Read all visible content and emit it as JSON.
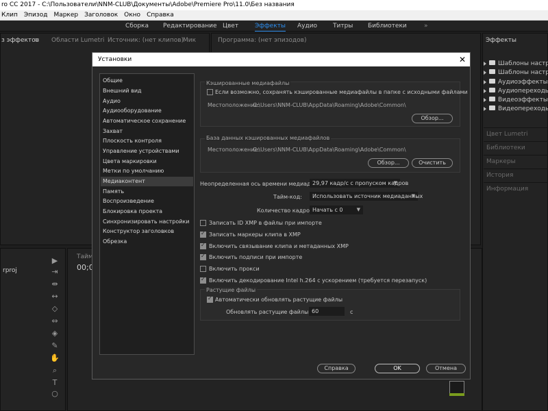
{
  "window": {
    "title": "ro CC 2017 - C:\\Пользователи\\NNM-CLUB\\Документы\\Adobe\\Premiere Pro\\11.0\\Без названия"
  },
  "menu": [
    "Клип",
    "Эпизод",
    "Маркер",
    "Заголовок",
    "Окно",
    "Справка"
  ],
  "workspaces": {
    "items": [
      "Сборка",
      "Редактирование",
      "Цвет",
      "Эффекты",
      "Аудио",
      "Титры",
      "Библиотеки"
    ],
    "active": "Эффекты",
    "more": "»"
  },
  "panels": {
    "effect_controls": "з эффектов",
    "lumetri_scopes": "Области Lumetri",
    "source": "Источник: (нет клипов)",
    "mixer": "Мик",
    "program": "Программа: (нет эпизодов)",
    "effects": "Эффекты",
    "timeline": "Тайм",
    "timecode": "00;0",
    "project_file": "rproj",
    "right_sections": [
      "Цвет Lumetri",
      "Библиотеки",
      "Маркеры",
      "История",
      "Информация"
    ],
    "effects_tree": [
      "Шаблоны настроек",
      "Шаблоны настроек",
      "Аудиоэффекты",
      "Аудиопереходы",
      "Видеоэффекты",
      "Видеопереходы"
    ]
  },
  "dialog": {
    "title": "Установки",
    "close": "✕",
    "categories": [
      "Общие",
      "Внешний вид",
      "Аудио",
      "Аудиооборудование",
      "Автоматическое сохранение",
      "Захват",
      "Плоскость контроля",
      "Управление устройствами",
      "Цвета маркировки",
      "Метки по умолчанию",
      "Медиаконтент",
      "Память",
      "Воспроизведение",
      "Блокировка проекта",
      "Синхронизировать настройки",
      "Конструктор заголовков",
      "Обрезка"
    ],
    "selected_category": "Медиаконтент",
    "cache": {
      "title": "Кэшированные медиафайлы",
      "checkbox": "Если возможно, сохранять кэшированные медиафайлы в папке с исходными файлами",
      "checked": false,
      "location_label": "Местоположение:",
      "location_value": "C:\\Users\\NNM-CLUB\\AppData\\Roaming\\Adobe\\Common\\",
      "browse": "Обзор..."
    },
    "db": {
      "title": "База данных кэшированных медиафайлов",
      "location_label": "Местоположение:",
      "location_value": "C:\\Users\\NNM-CLUB\\AppData\\Roaming\\Adobe\\Common\\",
      "browse": "Обзор...",
      "clean": "Очистить"
    },
    "timebase": {
      "label": "Неопределенная ось времени медиаданных:",
      "value": "29,97 кадр/с с пропуском кадров"
    },
    "timecode": {
      "label": "Тайм-код:",
      "value": "Использовать источник медиаданных"
    },
    "frame_count": {
      "label": "Количество кадров:",
      "value": "Начать с 0"
    },
    "checkboxes": [
      {
        "label": "Записать ID XMP в файлы при импорте",
        "checked": false
      },
      {
        "label": "Записать маркеры клипа в XMP",
        "checked": true
      },
      {
        "label": "Включить связывание клипа и метаданных XMP",
        "checked": true
      },
      {
        "label": "Включить подписи при импорте",
        "checked": true
      },
      {
        "label": "Включить прокси",
        "checked": false
      },
      {
        "label": "Включить декодирование Intel h.264 с ускорением (требуется перезапуск)",
        "checked": true
      }
    ],
    "growing": {
      "title": "Растущие файлы",
      "checkbox": "Автоматически обновлять растущие файлы",
      "checked": true,
      "refresh_label": "Обновлять растущие файлы раз в",
      "refresh_value": "60",
      "unit": "с"
    },
    "buttons": {
      "help": "Справка",
      "ok": "OK",
      "cancel": "Отмена"
    }
  }
}
